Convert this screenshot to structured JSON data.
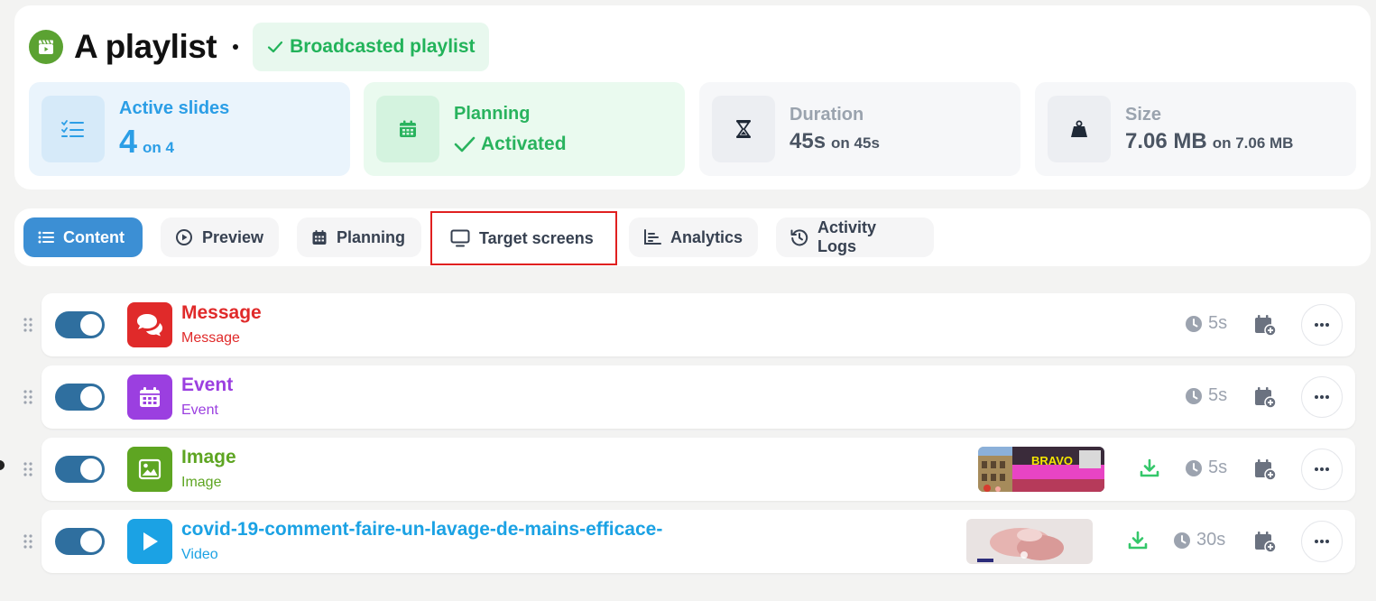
{
  "header": {
    "title": "A playlist",
    "status_badge": "Broadcasted playlist",
    "logo_icon": "clapperboard-icon"
  },
  "stats": {
    "active_slides": {
      "label": "Active slides",
      "value": "4",
      "total": "on 4",
      "icon": "checklist-icon"
    },
    "planning": {
      "label": "Planning",
      "value": "Activated",
      "icon": "calendar-icon"
    },
    "duration": {
      "label": "Duration",
      "value": "45s",
      "total": "on 45s",
      "icon": "hourglass-icon"
    },
    "size": {
      "label": "Size",
      "value": "7.06 MB",
      "total": "on 7.06 MB",
      "icon": "weight-icon"
    }
  },
  "tabs": [
    {
      "label": "Content",
      "icon": "list-icon",
      "active": true
    },
    {
      "label": "Preview",
      "icon": "play-circle-icon"
    },
    {
      "label": "Planning",
      "icon": "calendar-icon"
    },
    {
      "label": "Target screens",
      "icon": "monitor-icon",
      "highlighted": true
    },
    {
      "label": "Analytics",
      "icon": "bar-chart-icon"
    },
    {
      "label": "Activity Logs",
      "icon": "history-icon"
    }
  ],
  "slides": [
    {
      "title": "Message",
      "type": "Message",
      "duration": "5s",
      "color": "#e02a2a",
      "icon": "chat-bubbles-icon",
      "enabled": true
    },
    {
      "title": "Event",
      "type": "Event",
      "duration": "5s",
      "color": "#9b3fe0",
      "icon": "calendar-icon",
      "enabled": true
    },
    {
      "title": "Image",
      "type": "Image",
      "duration": "5s",
      "color": "#5ea522",
      "icon": "image-icon",
      "enabled": true,
      "thumbnail_text": "BRAVO"
    },
    {
      "title": "covid-19-comment-faire-un-lavage-de-mains-efficace-",
      "type": "Video",
      "duration": "30s",
      "color": "#1ba2e4",
      "icon": "play-icon",
      "enabled": true
    }
  ],
  "colors": {
    "accent_blue": "#3c8fd4",
    "green": "#29b35e",
    "highlight_red": "#e02020"
  }
}
